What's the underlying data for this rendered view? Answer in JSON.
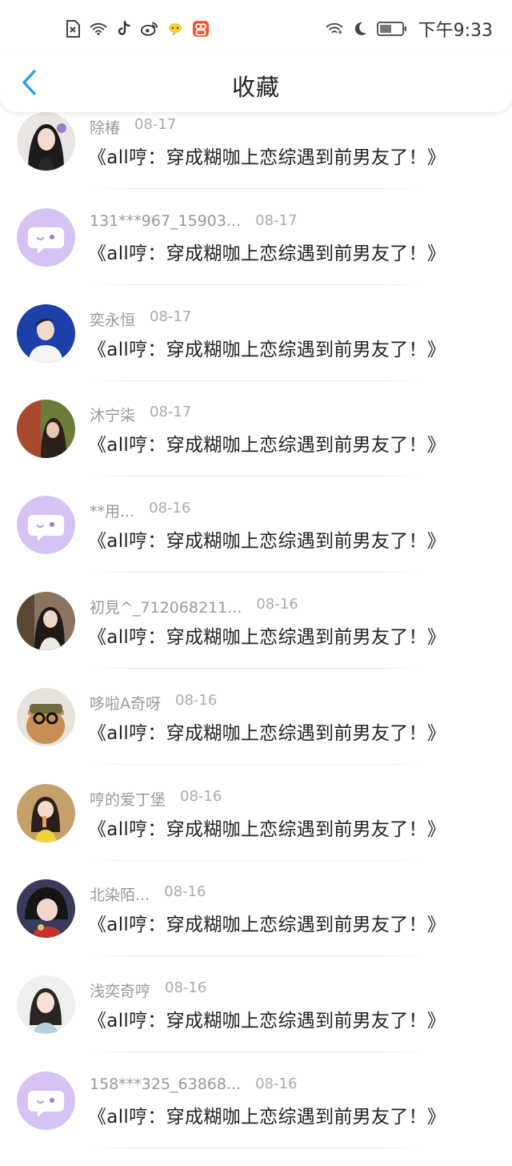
{
  "status_bar": {
    "time": "下午9:33",
    "left_icons": [
      "sim-off-icon",
      "wifi-icon",
      "tiktok-icon",
      "weibo-icon",
      "chat-bubble-icon",
      "app-icon"
    ],
    "right_icons": [
      "wifi-icon",
      "moon-icon",
      "battery-icon"
    ]
  },
  "header": {
    "title": "收藏",
    "back_icon": "chevron-left-icon",
    "accent_color": "#2a9ef0"
  },
  "items": [
    {
      "name": "除椿",
      "date": "08-17",
      "content": "《all哼：穿成糊咖上恋综遇到前男友了！》",
      "avatar": "photo-girl-dark-hair"
    },
    {
      "name": "131***967_15903...",
      "date": "08-17",
      "content": "《all哼：穿成糊咖上恋综遇到前男友了！》",
      "avatar": "default-chat-avatar"
    },
    {
      "name": "奕永恒",
      "date": "08-17",
      "content": "《all哼：穿成糊咖上恋综遇到前男友了！》",
      "avatar": "photo-boy-blue-bg"
    },
    {
      "name": "沐宁柒",
      "date": "08-17",
      "content": "《all哼：穿成糊咖上恋综遇到前男友了！》",
      "avatar": "photo-girl-green"
    },
    {
      "name": "**用...",
      "date": "08-16",
      "content": "《all哼：穿成糊咖上恋综遇到前男友了！》",
      "avatar": "default-chat-avatar"
    },
    {
      "name": "初見^_712068211...",
      "date": "08-16",
      "content": "《all哼：穿成糊咖上恋综遇到前男友了！》",
      "avatar": "photo-girl-brown"
    },
    {
      "name": "哆啦A奇呀",
      "date": "08-16",
      "content": "《all哼：穿成糊咖上恋综遇到前男友了！》",
      "avatar": "photo-bear-glasses"
    },
    {
      "name": "哼的爱丁堡",
      "date": "08-16",
      "content": "《all哼：穿成糊咖上恋综遇到前男友了！》",
      "avatar": "photo-girl-yellow"
    },
    {
      "name": "北染陌...",
      "date": "08-16",
      "content": "《all哼：穿成糊咖上恋综遇到前男友了！》",
      "avatar": "photo-girl-red"
    },
    {
      "name": "浅奕奇哼",
      "date": "08-16",
      "content": "《all哼：穿成糊咖上恋综遇到前男友了！》",
      "avatar": "photo-girl-light"
    },
    {
      "name": "158***325_63868...",
      "date": "08-16",
      "content": "《all哼：穿成糊咖上恋综遇到前男友了！》",
      "avatar": "default-chat-avatar"
    }
  ]
}
